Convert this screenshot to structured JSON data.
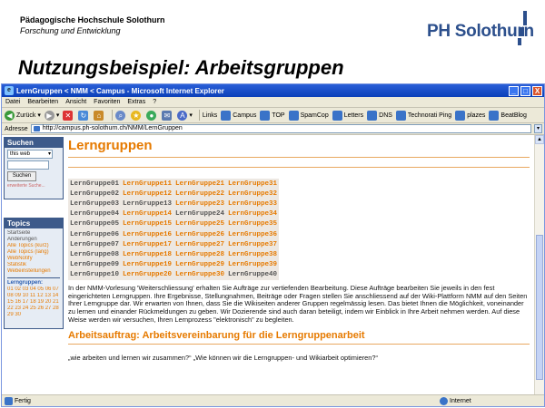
{
  "slide": {
    "institution": "Pädagogische Hochschule Solothurn",
    "department": "Forschung und Entwicklung",
    "logo_text": "PH Solothurn",
    "title": "Nutzungsbeispiel: Arbeitsgruppen"
  },
  "window": {
    "title": "LernGruppen < NMM < Campus - Microsoft Internet Explorer",
    "min": "_",
    "max": "□",
    "close": "X"
  },
  "menu": [
    "Datei",
    "Bearbeiten",
    "Ansicht",
    "Favoriten",
    "Extras",
    "?"
  ],
  "toolbar": {
    "back": "Zurück",
    "links_label": "Links",
    "links": [
      "Campus",
      "TOP",
      "SpamCop",
      "Letters",
      "DNS",
      "Technorati Ping",
      "plazes",
      "BeatBlog"
    ]
  },
  "address": {
    "label": "Adresse",
    "url": "http://campus.ph-solothurn.ch/NMM/LernGruppen"
  },
  "sidebar": {
    "search_head": "Suchen",
    "search_scope": "this web",
    "search_button": "Suchen",
    "search_advanced": "erweiterte Suche...",
    "topics_head": "Topics",
    "topics": [
      {
        "label": "Startseite",
        "color": "#555555"
      },
      {
        "label": "Änderungen",
        "color": "#555555"
      },
      {
        "label": "Alle Topics (kurz)",
        "color": "#e67a00"
      },
      {
        "label": "Alle Topics (lang)",
        "color": "#e67a00"
      },
      {
        "label": "WebNotify",
        "color": "#e67a00"
      },
      {
        "label": "Statistik",
        "color": "#e67a00"
      },
      {
        "label": "Webeinstellungen",
        "color": "#e67a00"
      }
    ],
    "groups_label": "Lerngruppen:",
    "group_number_lines": [
      "01 02 03 04 05 06 07",
      "08 09 10 11 12 13 14",
      "15 16 17 18 19 20 21",
      "22 23 24 25 26 27 28",
      "29 30"
    ]
  },
  "main": {
    "page_title": "Lerngruppen",
    "groups": [
      [
        "LernGruppe01",
        "LernGruppe11",
        "LernGruppe21",
        "LernGruppe31"
      ],
      [
        "LernGruppe02",
        "LernGruppe12",
        "LernGruppe22",
        "LernGruppe32"
      ],
      [
        "LernGruppe03",
        "LernGruppe13",
        "LernGruppe23",
        "LernGruppe33"
      ],
      [
        "LernGruppe04",
        "LernGruppe14",
        "LernGruppe24",
        "LernGruppe34"
      ],
      [
        "LernGruppe05",
        "LernGruppe15",
        "LernGruppe25",
        "LernGruppe35"
      ],
      [
        "LernGruppe06",
        "LernGruppe16",
        "LernGruppe26",
        "LernGruppe36"
      ],
      [
        "LernGruppe07",
        "LernGruppe17",
        "LernGruppe27",
        "LernGruppe37"
      ],
      [
        "LernGruppe08",
        "LernGruppe18",
        "LernGruppe28",
        "LernGruppe38"
      ],
      [
        "LernGruppe09",
        "LernGruppe19",
        "LernGruppe29",
        "LernGruppe39"
      ],
      [
        "LernGruppe10",
        "LernGruppe20",
        "LernGruppe30",
        "LernGruppe40"
      ]
    ],
    "current_groups": [
      "LernGruppe01",
      "LernGruppe02",
      "LernGruppe03",
      "LernGruppe04",
      "LernGruppe05",
      "LernGruppe06",
      "LernGruppe07",
      "LernGruppe08",
      "LernGruppe09",
      "LernGruppe10",
      "LernGruppe13",
      "LernGruppe24",
      "LernGruppe40"
    ],
    "intro": "In der NMM-Vorlesung 'Weiterschliessung' erhalten Sie Aufträge zur vertiefenden Bearbeitung. Diese Aufträge bearbeiten Sie jeweils in den fest eingerichteten Lerngruppen. Ihre Ergebnisse, Stellungnahmen, Beiträge oder Fragen stellen Sie anschliessend auf der Wiki-Plattform NMM auf den Seiten Ihrer Lerngruppe dar. Wir erwarten von Ihnen, dass Sie die Wikiseiten anderer Gruppen regelmässig lesen. Das bietet Ihnen die Möglichkeit, voneinander zu lernen und einander Rückmeldungen zu geben. Wir Dozierende sind auch daran beteiligt, indem wir Einblick in Ihre Arbeit nehmen werden. Auf diese Weise werden wir versuchen, Ihren Lernprozess \"elektronisch\" zu begleiten.",
    "section_title": "Arbeitsauftrag: Arbeitsvereinbarung für die Lerngruppenarbeit",
    "question": "„wie arbeiten und lernen wir zusammen?“ „Wie können wir die Lerngruppen- und Wikiarbeit optimieren?“"
  },
  "status": {
    "left": "Fertig",
    "zone": "Internet"
  },
  "colors": {
    "accent": "#e67a00",
    "link_blue": "#2a5db0",
    "xp_title": "#0a3fb8",
    "sidebar_head": "#3d5a8a"
  }
}
